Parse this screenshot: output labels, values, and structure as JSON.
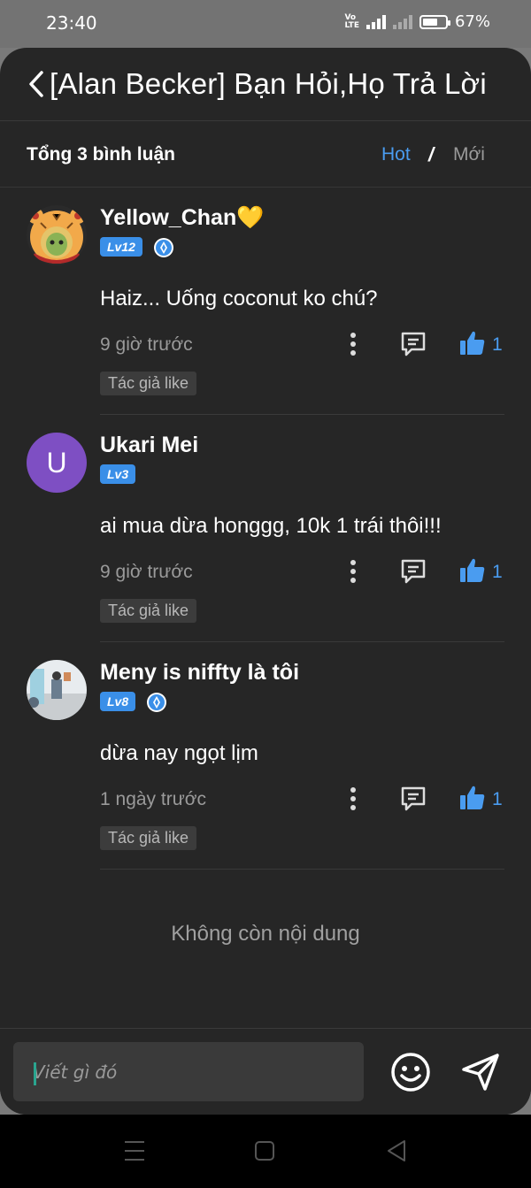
{
  "status": {
    "time": "23:40",
    "network_badge": "Vo LTE",
    "battery": "67%",
    "battery_level": 0.67
  },
  "header": {
    "title": "[Alan Becker] Bạn Hỏi,Họ Trả Lời"
  },
  "subheader": {
    "total": "Tổng 3 bình luận",
    "sort_hot": "Hot",
    "separator": "/",
    "sort_new": "Mới"
  },
  "comments": [
    {
      "username": "Yellow_Chan💛",
      "level": "Lv12",
      "verified": true,
      "text": "Haiz... Uống coconut ko chú?",
      "time": "9 giờ trước",
      "likes": "1",
      "author_like": "Tác giả like"
    },
    {
      "username": "Ukari Mei",
      "avatar_letter": "U",
      "level": "Lv3",
      "verified": false,
      "text": "ai mua dừa honggg, 10k 1 trái thôi!!!",
      "time": "9 giờ trước",
      "likes": "1",
      "author_like": "Tác giả like"
    },
    {
      "username": "Meny is niffty là tôi",
      "level": "Lv8",
      "verified": true,
      "text": "dừa nay ngọt lịm",
      "time": "1 ngày trước",
      "likes": "1",
      "author_like": "Tác giả like"
    }
  ],
  "footer": {
    "no_more": "Không còn nội dung"
  },
  "input": {
    "placeholder": "Viết gì đó"
  },
  "colors": {
    "accent": "#4a9cf0",
    "background": "#262626",
    "badge": "#3a8fe8"
  }
}
